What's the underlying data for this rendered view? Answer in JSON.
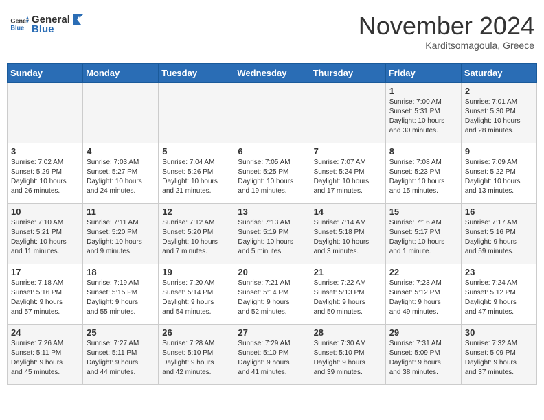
{
  "header": {
    "logo": {
      "text_general": "General",
      "text_blue": "Blue"
    },
    "month": "November 2024",
    "location": "Karditsomagoula, Greece"
  },
  "weekdays": [
    "Sunday",
    "Monday",
    "Tuesday",
    "Wednesday",
    "Thursday",
    "Friday",
    "Saturday"
  ],
  "weeks": [
    [
      {
        "day": "",
        "info": ""
      },
      {
        "day": "",
        "info": ""
      },
      {
        "day": "",
        "info": ""
      },
      {
        "day": "",
        "info": ""
      },
      {
        "day": "",
        "info": ""
      },
      {
        "day": "1",
        "info": "Sunrise: 7:00 AM\nSunset: 5:31 PM\nDaylight: 10 hours\nand 30 minutes."
      },
      {
        "day": "2",
        "info": "Sunrise: 7:01 AM\nSunset: 5:30 PM\nDaylight: 10 hours\nand 28 minutes."
      }
    ],
    [
      {
        "day": "3",
        "info": "Sunrise: 7:02 AM\nSunset: 5:29 PM\nDaylight: 10 hours\nand 26 minutes."
      },
      {
        "day": "4",
        "info": "Sunrise: 7:03 AM\nSunset: 5:27 PM\nDaylight: 10 hours\nand 24 minutes."
      },
      {
        "day": "5",
        "info": "Sunrise: 7:04 AM\nSunset: 5:26 PM\nDaylight: 10 hours\nand 21 minutes."
      },
      {
        "day": "6",
        "info": "Sunrise: 7:05 AM\nSunset: 5:25 PM\nDaylight: 10 hours\nand 19 minutes."
      },
      {
        "day": "7",
        "info": "Sunrise: 7:07 AM\nSunset: 5:24 PM\nDaylight: 10 hours\nand 17 minutes."
      },
      {
        "day": "8",
        "info": "Sunrise: 7:08 AM\nSunset: 5:23 PM\nDaylight: 10 hours\nand 15 minutes."
      },
      {
        "day": "9",
        "info": "Sunrise: 7:09 AM\nSunset: 5:22 PM\nDaylight: 10 hours\nand 13 minutes."
      }
    ],
    [
      {
        "day": "10",
        "info": "Sunrise: 7:10 AM\nSunset: 5:21 PM\nDaylight: 10 hours\nand 11 minutes."
      },
      {
        "day": "11",
        "info": "Sunrise: 7:11 AM\nSunset: 5:20 PM\nDaylight: 10 hours\nand 9 minutes."
      },
      {
        "day": "12",
        "info": "Sunrise: 7:12 AM\nSunset: 5:20 PM\nDaylight: 10 hours\nand 7 minutes."
      },
      {
        "day": "13",
        "info": "Sunrise: 7:13 AM\nSunset: 5:19 PM\nDaylight: 10 hours\nand 5 minutes."
      },
      {
        "day": "14",
        "info": "Sunrise: 7:14 AM\nSunset: 5:18 PM\nDaylight: 10 hours\nand 3 minutes."
      },
      {
        "day": "15",
        "info": "Sunrise: 7:16 AM\nSunset: 5:17 PM\nDaylight: 10 hours\nand 1 minute."
      },
      {
        "day": "16",
        "info": "Sunrise: 7:17 AM\nSunset: 5:16 PM\nDaylight: 9 hours\nand 59 minutes."
      }
    ],
    [
      {
        "day": "17",
        "info": "Sunrise: 7:18 AM\nSunset: 5:16 PM\nDaylight: 9 hours\nand 57 minutes."
      },
      {
        "day": "18",
        "info": "Sunrise: 7:19 AM\nSunset: 5:15 PM\nDaylight: 9 hours\nand 55 minutes."
      },
      {
        "day": "19",
        "info": "Sunrise: 7:20 AM\nSunset: 5:14 PM\nDaylight: 9 hours\nand 54 minutes."
      },
      {
        "day": "20",
        "info": "Sunrise: 7:21 AM\nSunset: 5:14 PM\nDaylight: 9 hours\nand 52 minutes."
      },
      {
        "day": "21",
        "info": "Sunrise: 7:22 AM\nSunset: 5:13 PM\nDaylight: 9 hours\nand 50 minutes."
      },
      {
        "day": "22",
        "info": "Sunrise: 7:23 AM\nSunset: 5:12 PM\nDaylight: 9 hours\nand 49 minutes."
      },
      {
        "day": "23",
        "info": "Sunrise: 7:24 AM\nSunset: 5:12 PM\nDaylight: 9 hours\nand 47 minutes."
      }
    ],
    [
      {
        "day": "24",
        "info": "Sunrise: 7:26 AM\nSunset: 5:11 PM\nDaylight: 9 hours\nand 45 minutes."
      },
      {
        "day": "25",
        "info": "Sunrise: 7:27 AM\nSunset: 5:11 PM\nDaylight: 9 hours\nand 44 minutes."
      },
      {
        "day": "26",
        "info": "Sunrise: 7:28 AM\nSunset: 5:10 PM\nDaylight: 9 hours\nand 42 minutes."
      },
      {
        "day": "27",
        "info": "Sunrise: 7:29 AM\nSunset: 5:10 PM\nDaylight: 9 hours\nand 41 minutes."
      },
      {
        "day": "28",
        "info": "Sunrise: 7:30 AM\nSunset: 5:10 PM\nDaylight: 9 hours\nand 39 minutes."
      },
      {
        "day": "29",
        "info": "Sunrise: 7:31 AM\nSunset: 5:09 PM\nDaylight: 9 hours\nand 38 minutes."
      },
      {
        "day": "30",
        "info": "Sunrise: 7:32 AM\nSunset: 5:09 PM\nDaylight: 9 hours\nand 37 minutes."
      }
    ]
  ]
}
